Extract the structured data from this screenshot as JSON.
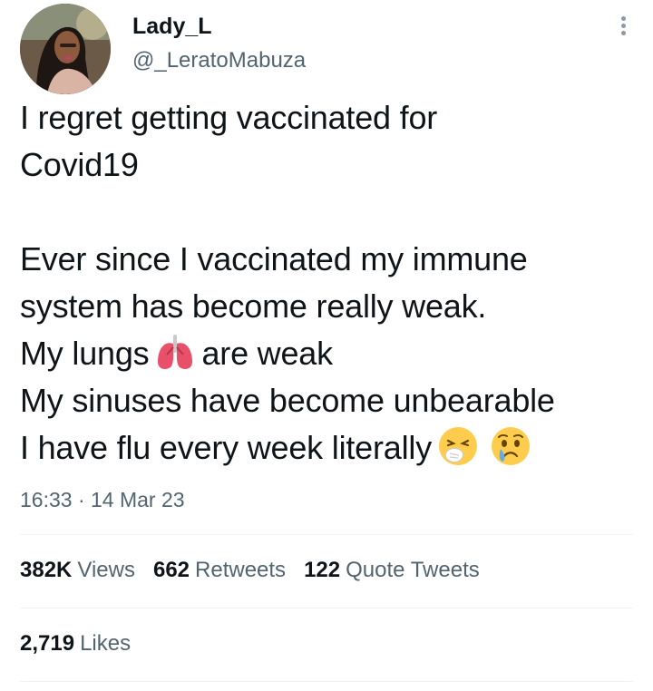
{
  "author": {
    "display_name": "Lady_L",
    "handle": "@_LeratoMabuza"
  },
  "tweet": {
    "lines": [
      "I regret getting vaccinated for",
      "Covid19",
      "",
      "Ever since I vaccinated my immune",
      "system has become really weak.",
      "My lungs",
      "are weak",
      "My sinuses have become unbearable",
      "I have flu every week literally"
    ],
    "emojis": [
      "lungs-emoji",
      "sneezing-face-emoji",
      "crying-face-emoji"
    ]
  },
  "timestamp": "16:33 · 14 Mar 23",
  "stats": {
    "views_count": "382K",
    "views_label": "Views",
    "retweets_count": "662",
    "retweets_label": "Retweets",
    "quotes_count": "122",
    "quotes_label": "Quote Tweets",
    "likes_count": "2,719",
    "likes_label": "Likes"
  },
  "colors": {
    "text_primary": "#0f1419",
    "text_secondary": "#536471",
    "divider": "#eff3f4"
  }
}
